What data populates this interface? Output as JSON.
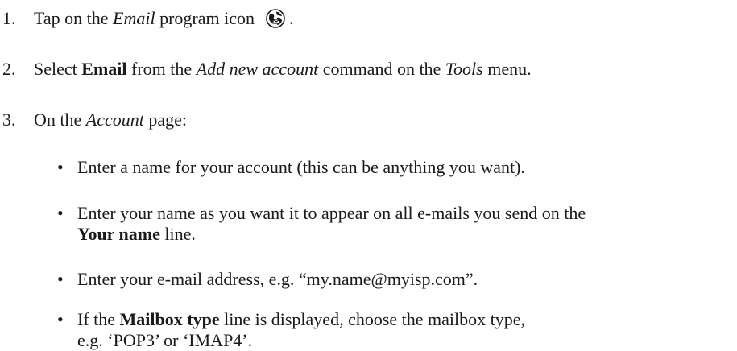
{
  "steps": [
    {
      "number": "1.",
      "parts": {
        "a": "Tap on the ",
        "b": "Email",
        "c": " program icon",
        "d": "."
      },
      "icon": "email-globe-icon"
    },
    {
      "number": "2.",
      "parts": {
        "a": "Select ",
        "b": "Email",
        "c": " from the ",
        "d": "Add new account",
        "e": " command on the ",
        "f": "Tools",
        "g": " menu."
      }
    },
    {
      "number": "3.",
      "parts": {
        "a": "On the ",
        "b": "Account",
        "c": " page:"
      },
      "bullets": [
        {
          "text": "Enter a name for your account (this can be anything you want)."
        },
        {
          "line1": "Enter your name as you want it to appear on all e-mails you send on the",
          "bold": "Your name",
          "tail": " line."
        },
        {
          "text": "Enter your e-mail address, e.g. “my.name@myisp.com”."
        },
        {
          "pre": "If the ",
          "bold": "Mailbox type",
          "post": " line is displayed, choose the mailbox type,",
          "line2": "e.g. ‘POP3’ or ‘IMAP4’."
        }
      ]
    }
  ],
  "bullet_glyph": "•"
}
